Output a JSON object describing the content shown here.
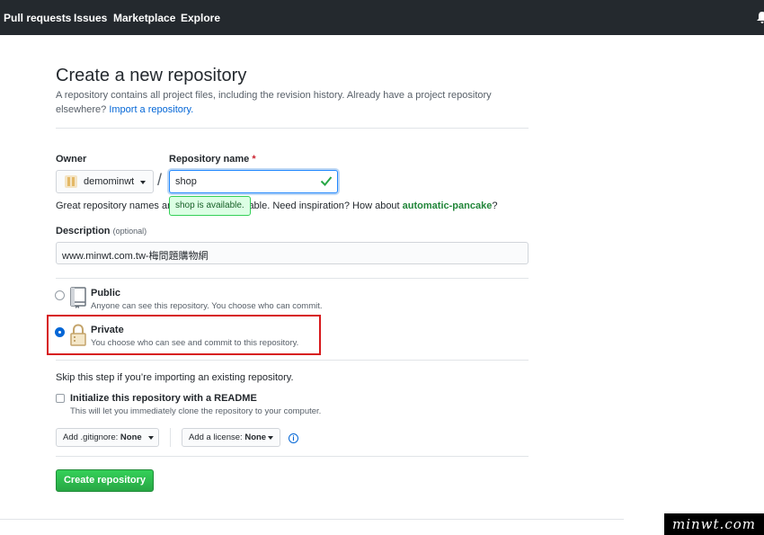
{
  "nav": {
    "items": [
      "Pull requests",
      "Issues",
      "Marketplace",
      "Explore"
    ],
    "notification_icon": "bell-icon"
  },
  "page": {
    "title": "Create a new repository",
    "subtitle": "A repository contains all project files, including the revision history. Already have a project repository elsewhere?",
    "import_link": "Import a repository."
  },
  "owner": {
    "label": "Owner",
    "value": "demominwt"
  },
  "repo": {
    "label": "Repository name",
    "required_mark": "*",
    "value": "shop",
    "available_tooltip": "shop is available."
  },
  "hint": {
    "prefix": "Great repository names ar",
    "suffix": "rable. Need inspiration? How about",
    "suggestion": "automatic-pancake",
    "end": "?"
  },
  "description": {
    "label": "Description",
    "optional": "(optional)",
    "value": "www.minwt.com.tw-梅問題購物網"
  },
  "visibility": {
    "public_title": "Public",
    "public_desc": "Anyone can see this repository. You choose who can commit.",
    "private_title": "Private",
    "private_desc": "You choose who can see and commit to this repository.",
    "selected": "Private"
  },
  "init": {
    "skip_text": "Skip this step if you’re importing an existing repository.",
    "readme_label": "Initialize this repository with a README",
    "readme_desc": "This will let you immediately clone the repository to your computer.",
    "readme_checked": false
  },
  "selects": {
    "gitignore_label": "Add .gitignore:",
    "gitignore_value": "None",
    "license_label": "Add a license:",
    "license_value": "None",
    "info_glyph": "i"
  },
  "actions": {
    "create_label": "Create repository"
  },
  "watermark": "minwt.com",
  "colors": {
    "nav_bg": "#24292e",
    "link": "#0366d6",
    "success": "#28a745",
    "highlight_box": "#d7191c"
  }
}
